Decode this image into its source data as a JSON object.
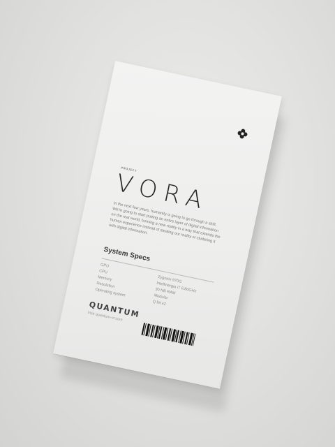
{
  "card": {
    "tagline": "PROJECT",
    "title": "VORA",
    "intro": "In the next few years, humanity is going to go through a shift. We're going to start putting an entire layer of digital information on the real world, forming a new reality in a way that extends the human experience instead of stealing our reality or cluttering it with digital information.",
    "specs_title": "System Specs",
    "spec_labels": [
      "GPU",
      "CPU",
      "Memory",
      "Resolution",
      "Operating system"
    ],
    "spec_values": [
      "Zygonix 970G",
      "Intellinergia i7 6.80GHz",
      "30 NB RAM",
      "Modular",
      "Q bit v2"
    ],
    "brand": "QUANTUM",
    "website": "Visit quantum-vr.com",
    "logo_icon": "flower-logo-icon",
    "barcode_icon": "barcode-icon"
  },
  "colors": {
    "background": "#e2e2e0",
    "card": "#efefee",
    "title": "#262626",
    "body_text": "#7a7a7a"
  }
}
